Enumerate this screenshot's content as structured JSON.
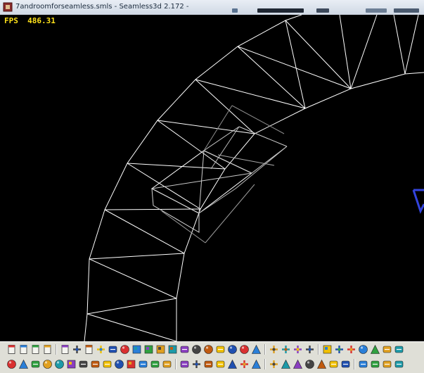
{
  "window": {
    "title": "7androomforseamless.smls - Seamless3d 2.172 -"
  },
  "viewport": {
    "fps_label": "FPS",
    "fps_value": "486.31"
  },
  "colors": {
    "fps_text": "#ffe21a",
    "wireframe": "#ffffff",
    "cursor_blue": "#3344dd",
    "toolbar_bg": "#dfdfd7"
  },
  "toolbars": {
    "row1": [
      "new-file-icon",
      "open-folder-icon",
      "open-network-icon",
      "save-icon",
      "sep",
      "paste-icon",
      "tree-icon",
      "copy-icon",
      "link-icon",
      "shape-icon",
      "sphere-icon",
      "grid-icon",
      "bricks-icon",
      "box-outline-icon",
      "window-icon",
      "connector-icon",
      "teal-sphere-icon",
      "teal-sphere-icon",
      "teal-cup-icon",
      "teal-sphere-icon",
      "dark-sphere-icon",
      "pointer-icon",
      "sep",
      "scale-icon",
      "red-hand-icon",
      "red-plus-icon",
      "red-rotate-icon",
      "sep",
      "square-icon",
      "move-icon",
      "move-icon",
      "face-icon",
      "arrow-up-icon",
      "vertical-bar-icon",
      "help-icon"
    ],
    "row2": [
      "purple-sphere-icon",
      "cone-icon",
      "cylinder-icon",
      "orange-torus-icon",
      "face-icon",
      "green-box-icon",
      "cylinder-icon",
      "mesh-icon",
      "dice-icon",
      "sphere-icon",
      "red-cube-icon",
      "figure-icon",
      "pot-icon",
      "wrench-icon",
      "sep",
      "select-icon",
      "hand-icon",
      "sort-icon",
      "fill-icon",
      "cursor-icon",
      "plus-icon",
      "arrow-icon",
      "sep",
      "move-icon",
      "triangle-icon",
      "triangle-down-icon",
      "counter-icon",
      "fork-icon",
      "fan-icon",
      "lamp-icon",
      "sep",
      "landscape-icon",
      "road-icon",
      "terrain-icon",
      "zoom-icon"
    ]
  }
}
